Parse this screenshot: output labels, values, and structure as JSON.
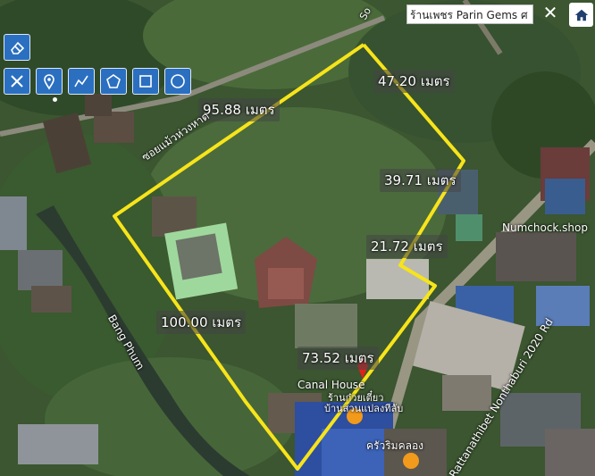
{
  "search": {
    "value": "ร้านเพชร Parin Gems ศ"
  },
  "close_glyph": "✕",
  "colors": {
    "boundary": "#f7e41a",
    "toolbar": "#2b6fc0",
    "marker_red": "#e0201b",
    "marker_orange": "#f29a1b"
  },
  "toolbar": {
    "buttons": [
      {
        "icon": "eraser-icon"
      },
      {
        "icon": "cross-tools-icon"
      },
      {
        "icon": "location-pin-icon"
      },
      {
        "icon": "polyline-icon"
      },
      {
        "icon": "polygon-icon"
      },
      {
        "icon": "rectangle-icon"
      },
      {
        "icon": "circle-icon"
      }
    ]
  },
  "measurements": {
    "m1": "47.20 เมตร",
    "m2": "95.88 เมตร",
    "m3": "39.71 เมตร",
    "m4": "21.72 เมตร",
    "m5": "100.00 เมตร",
    "m6": "73.52 เมตร"
  },
  "places": {
    "soi_road": "ซอยแม้วห่วงหาด",
    "bang_phum": "Bang Phum",
    "numchock": "Numchock.shop",
    "canal_house": "Canal House",
    "shop_cafe": "ร้านก๋วยเตี๋ยว",
    "shop_sub": "บ้านสวนแปลงทีลับ",
    "restaurant": "ครัวริมคลอง",
    "main_road": "Rattanathibet Nonthaburi 2020 Rd",
    "so_top": "So"
  }
}
